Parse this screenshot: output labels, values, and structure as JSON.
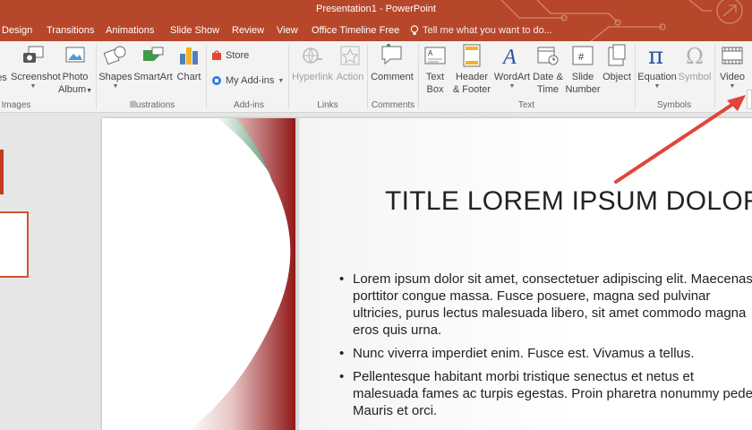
{
  "window": {
    "title": "Presentation1 - PowerPoint"
  },
  "tabs": [
    "Design",
    "Transitions",
    "Animations",
    "Slide Show",
    "Review",
    "View",
    "Office Timeline Free"
  ],
  "tell_me": "Tell me what you want to do...",
  "ribbon": {
    "images": {
      "partial_label": "es",
      "screenshot": "Screenshot",
      "photo_album_line1": "Photo",
      "photo_album_line2": "Album",
      "group": "Images"
    },
    "illustrations": {
      "shapes": "Shapes",
      "smartart": "SmartArt",
      "chart": "Chart",
      "group": "Illustrations"
    },
    "addins": {
      "store": "Store",
      "my_addins": "My Add-ins",
      "group": "Add-ins"
    },
    "links": {
      "hyperlink": "Hyperlink",
      "action": "Action",
      "group": "Links"
    },
    "comments": {
      "comment": "Comment",
      "group": "Comments"
    },
    "text": {
      "textbox_line1": "Text",
      "textbox_line2": "Box",
      "header_line1": "Header",
      "header_line2": "& Footer",
      "wordart": "WordArt",
      "datetime_line1": "Date &",
      "datetime_line2": "Time",
      "slidenumber_line1": "Slide",
      "slidenumber_line2": "Number",
      "object": "Object",
      "group": "Text"
    },
    "symbols": {
      "equation": "Equation",
      "symbol": "Symbol",
      "group": "Symbols"
    },
    "media": {
      "video": "Video"
    }
  },
  "slide": {
    "title": "TITLE LOREM IPSUM DOLOR",
    "bullets": [
      "Lorem ipsum dolor sit amet, consectetuer adipiscing elit. Maecenas porttitor congue massa. Fusce posuere, magna sed pulvinar ultricies, purus lectus malesuada libero, sit amet commodo magna eros quis urna.",
      "Nunc viverra imperdiet enim. Fusce est. Vivamus a tellus.",
      "Pellentesque habitant morbi tristique senectus et netus et malesuada fames ac turpis egestas. Proin pharetra nonummy pede. Mauris et orci."
    ]
  },
  "colors": {
    "accent": "#b7472a",
    "annotation_arrow": "#e0453a",
    "ribbon_bg": "#f3f3f3"
  }
}
